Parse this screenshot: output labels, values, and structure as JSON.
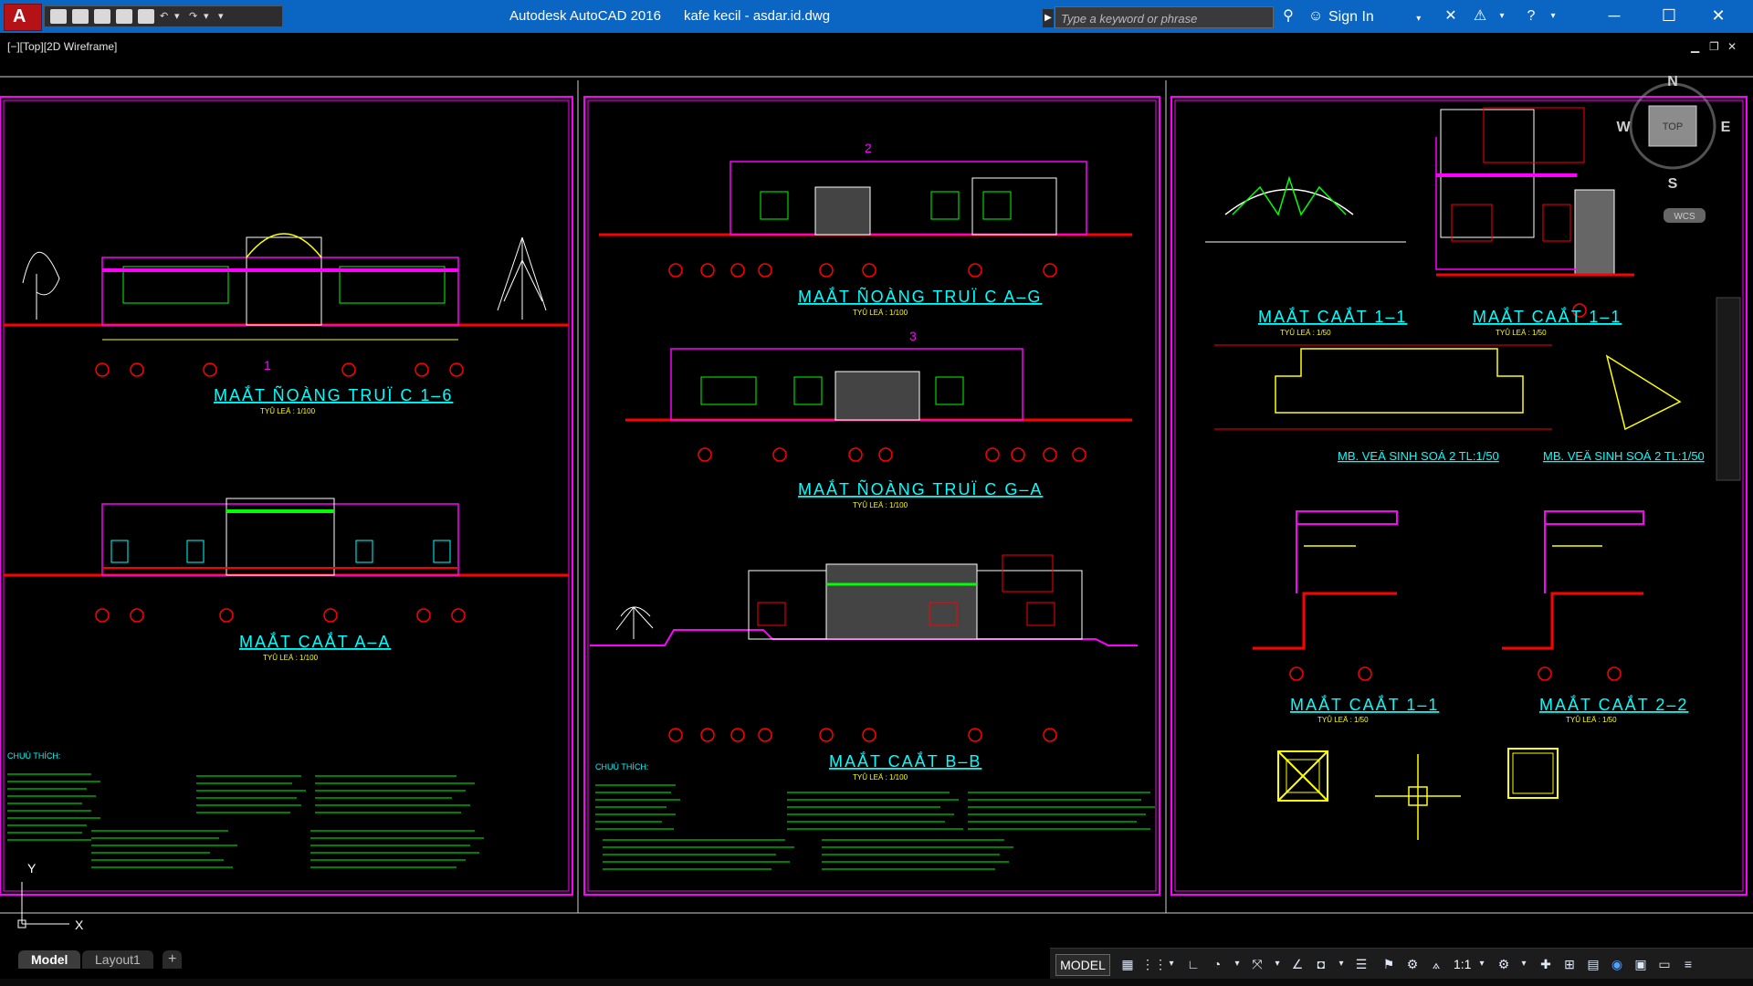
{
  "app": {
    "title": "Autodesk AutoCAD 2016",
    "filename": "kafe kecil - asdar.id.dwg",
    "logo_letter": "A"
  },
  "search": {
    "placeholder": "Type a keyword or phrase"
  },
  "account": {
    "signin_label": "Sign In"
  },
  "viewport": {
    "label": "[−][Top][2D Wireframe]"
  },
  "viewcube": {
    "north": "N",
    "south": "S",
    "east": "E",
    "west": "W",
    "face": "TOP",
    "ucs": "WCS"
  },
  "sheets": [
    {
      "drawings": [
        {
          "title": "MAẮT ÑOÀNG TRUÏ C 1–6",
          "scale": "TYÛ LEÄ : 1/100"
        },
        {
          "title": "MAẮT CAẮT A–A",
          "scale": "TYÛ LEÄ : 1/100"
        }
      ],
      "notes_heading": "CHUÙ THÍCH:"
    },
    {
      "drawings": [
        {
          "title": "MAẮT ÑOÀNG TRUÏ C A–G",
          "scale": "TYÛ LEÄ : 1/100"
        },
        {
          "title": "MAẮT ÑOÀNG TRUÏ C G–A",
          "scale": "TYÛ LEÄ : 1/100"
        },
        {
          "title": "MAẮT CAẮT B–B",
          "scale": "TYÛ LEÄ : 1/100"
        }
      ],
      "notes_heading": "CHUÙ THÍCH:"
    },
    {
      "drawings": [
        {
          "title": "MAẮT CAẮT 1–1",
          "scale": "TYÛ LEÄ : 1/50"
        },
        {
          "title": "MAẮT CAẮT 1–1",
          "scale": "TYÛ LEÄ : 1/50"
        },
        {
          "title": "MB. VEÄ SINH SOÁ 2 TL:1/50"
        },
        {
          "title": "MB. VEÄ SINH SOÁ 2 TL:1/50"
        },
        {
          "title": "MAẮT CAẮT 1–1",
          "scale": "TYÛ LEÄ : 1/50"
        },
        {
          "title": "MAẮT CAẮT 2–2",
          "scale": "TYÛ LEÄ : 1/50"
        }
      ]
    }
  ],
  "grid_marks": [
    "1",
    "2",
    "3"
  ],
  "ucs_icon": {
    "x": "X",
    "y": "Y"
  },
  "layout_tabs": [
    {
      "label": "Model",
      "active": true
    },
    {
      "label": "Layout1",
      "active": false
    }
  ],
  "add_tab_label": "+",
  "status": {
    "model_label": "MODEL",
    "annotation_scale": "1:1"
  },
  "colors": {
    "titlebar": "#0b65c2",
    "canvas": "#000000",
    "sheet_border": "#ff00ff",
    "title_text": "#00ffff",
    "ground": "#ff0000",
    "frame": "#ffff00",
    "green": "#00ff00"
  }
}
